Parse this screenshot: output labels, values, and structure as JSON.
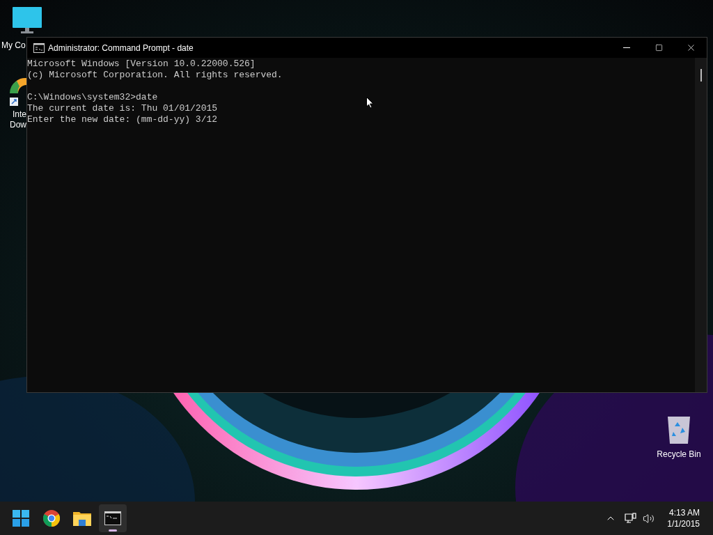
{
  "desktop_icons": [
    {
      "kind": "computer",
      "label": "My Co"
    },
    {
      "kind": "installer",
      "label": "Inte",
      "label_2": "Dow"
    },
    {
      "kind": "recycle",
      "label": "Recycle Bin"
    }
  ],
  "window": {
    "title": "Administrator: Command Prompt - date",
    "output": [
      [
        "Microsoft Windows [Version 10.0.22000.526]",
        "(c) Microsoft Corporation. All rights reserved."
      ],
      [
        "C:\\Windows\\system32>date",
        "The current date is: Thu 01/01/2015",
        "Enter the new date: (mm-dd-yy) 3/12"
      ]
    ]
  },
  "taskbar": {
    "apps": [
      {
        "kind": "start",
        "selected": false
      },
      {
        "kind": "browser",
        "selected": false
      },
      {
        "kind": "folder",
        "selected": false
      },
      {
        "kind": "terminal",
        "selected": true
      }
    ],
    "clock": {
      "time": "4:13 AM",
      "date": "1/1/2015"
    }
  }
}
